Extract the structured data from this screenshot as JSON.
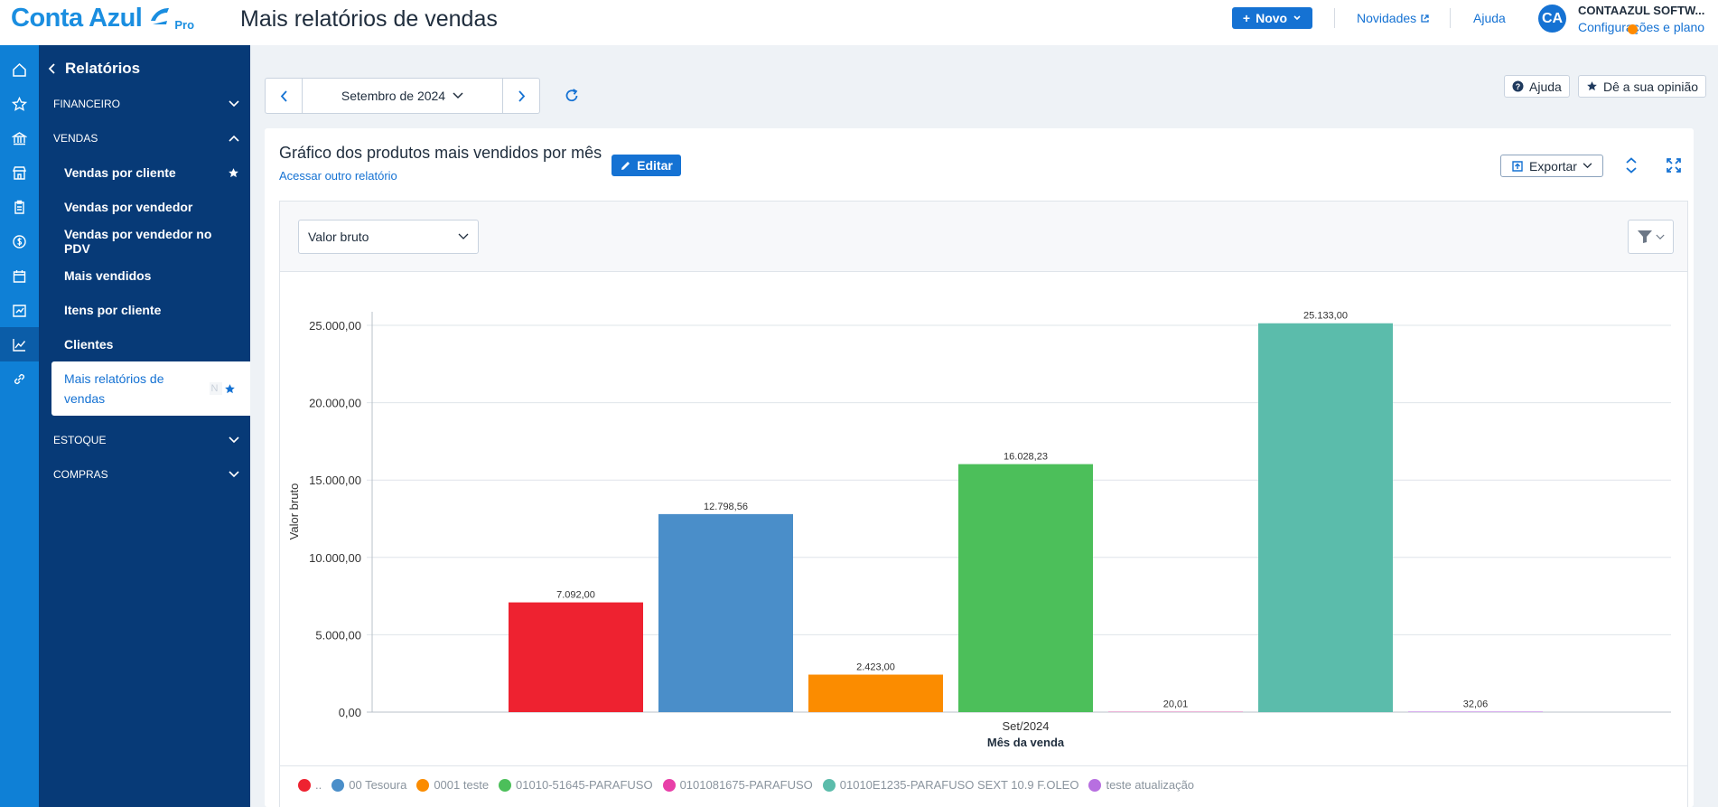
{
  "brand": {
    "name": "Conta Azul",
    "tier": "Pro"
  },
  "header": {
    "title": "Mais relatórios de vendas",
    "new_button": "Novo",
    "news_link": "Novidades",
    "help_link": "Ajuda",
    "avatar_initials": "CA",
    "company_name": "CONTAAZUL SOFTW...",
    "config_link": "Configurações e plano"
  },
  "sidebar": {
    "back_title": "Relatórios",
    "sections": {
      "financeiro": "FINANCEIRO",
      "vendas": "VENDAS",
      "estoque": "ESTOQUE",
      "compras": "COMPRAS"
    },
    "items": [
      {
        "label": "Vendas por cliente",
        "starred": true
      },
      {
        "label": "Vendas por vendedor"
      },
      {
        "label": "Vendas por vendedor no PDV"
      },
      {
        "label": "Mais vendidos"
      },
      {
        "label": "Itens por cliente"
      },
      {
        "label": "Clientes"
      },
      {
        "label": "Mais relatórios de vendas",
        "tag": "N",
        "starred": true,
        "active": true
      }
    ]
  },
  "toolbar": {
    "period": "Setembro de 2024",
    "help_button": "Ajuda",
    "feedback_button": "Dê a sua opinião"
  },
  "report": {
    "title": "Gráfico dos produtos mais vendidos por mês",
    "other_link": "Acessar outro relatório",
    "edit_button": "Editar",
    "export_button": "Exportar",
    "metric_select": "Valor bruto"
  },
  "colors": {
    "primary": "#1572d3",
    "sidebar": "#073a77",
    "rail": "#0f80d6"
  },
  "chart_data": {
    "type": "bar",
    "categories": [
      "Set/2024"
    ],
    "xlabel": "Mês da venda",
    "ylabel": "Valor bruto",
    "ylim": [
      0,
      25000
    ],
    "yticks": [
      "0,00",
      "5.000,00",
      "10.000,00",
      "15.000,00",
      "20.000,00",
      "25.000,00"
    ],
    "grid": true,
    "legend_position": "bottom",
    "series": [
      {
        "name": "..",
        "color": "#ee2230",
        "value": 7092.0,
        "label": "7.092,00"
      },
      {
        "name": "00 Tesoura",
        "color": "#4a8ec9",
        "value": 12798.56,
        "label": "12.798,56"
      },
      {
        "name": "0001 teste",
        "color": "#fb8c00",
        "value": 2423.0,
        "label": "2.423,00"
      },
      {
        "name": "01010-51645-PARAFUSO",
        "color": "#4cbf5a",
        "value": 16028.23,
        "label": "16.028,23"
      },
      {
        "name": "0101081675-PARAFUSO",
        "color": "#e83fa8",
        "value": 20.01,
        "label": "20,01"
      },
      {
        "name": "01010E1235-PARAFUSO SEXT 10.9 F.OLEO",
        "color": "#5bbcab",
        "value": 25133.0,
        "label": "25.133,00"
      },
      {
        "name": "teste atualização",
        "color": "#b76fe0",
        "value": 32.06,
        "label": "32,06"
      }
    ]
  }
}
